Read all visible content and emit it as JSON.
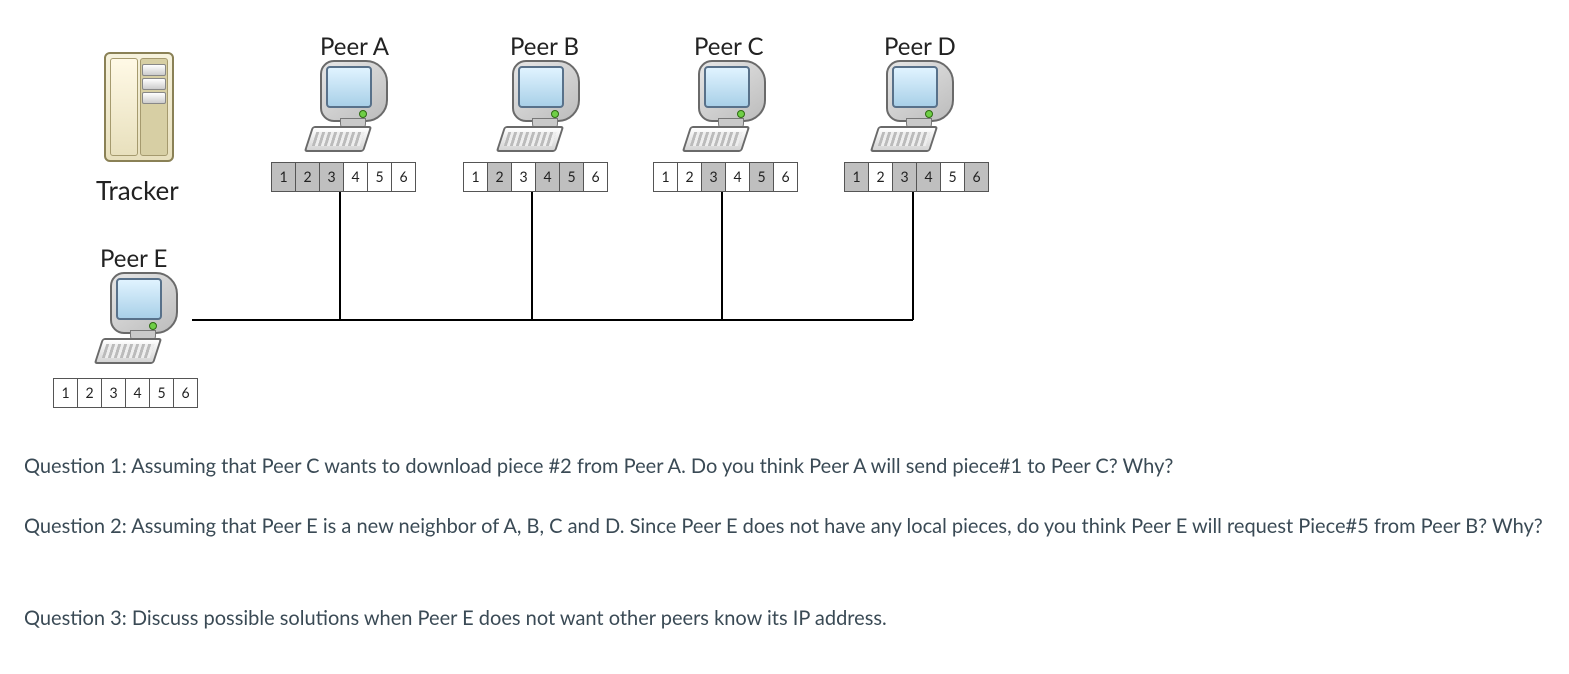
{
  "tracker": {
    "label": "Tracker"
  },
  "peers": {
    "A": {
      "label": "Peer A",
      "pieces": [
        1,
        1,
        1,
        0,
        0,
        0
      ]
    },
    "B": {
      "label": "Peer B",
      "pieces": [
        0,
        1,
        0,
        1,
        1,
        0
      ]
    },
    "C": {
      "label": "Peer C",
      "pieces": [
        0,
        0,
        1,
        0,
        1,
        0
      ]
    },
    "D": {
      "label": "Peer D",
      "pieces": [
        1,
        0,
        1,
        1,
        0,
        1
      ]
    },
    "E": {
      "label": "Peer E",
      "pieces": [
        0,
        0,
        0,
        0,
        0,
        0
      ]
    }
  },
  "piece_labels": [
    "1",
    "2",
    "3",
    "4",
    "5",
    "6"
  ],
  "questions": {
    "q1": "Question 1:  Assuming that Peer C wants to download piece #2 from Peer A.  Do you think Peer A will send piece#1 to Peer C? Why?",
    "q2": "Question 2: Assuming that Peer E is a new neighbor of A, B, C and D.  Since Peer E does not have any local pieces, do you think Peer E will request Piece#5 from Peer B? Why?",
    "q3": "Question 3: Discuss possible solutions when Peer E does not want other peers know its IP address."
  },
  "chart_data": {
    "type": "table",
    "title": "BitTorrent peers and the file pieces they currently hold",
    "piece_ids": [
      1,
      2,
      3,
      4,
      5,
      6
    ],
    "peers": [
      {
        "name": "Peer A",
        "has_pieces": [
          1,
          2,
          3
        ]
      },
      {
        "name": "Peer B",
        "has_pieces": [
          2,
          4,
          5
        ]
      },
      {
        "name": "Peer C",
        "has_pieces": [
          3,
          5
        ]
      },
      {
        "name": "Peer D",
        "has_pieces": [
          1,
          3,
          4,
          6
        ]
      },
      {
        "name": "Peer E",
        "has_pieces": []
      }
    ],
    "tracker": "Tracker",
    "topology": "Peer E is connected to Peer A, Peer B, Peer C and Peer D"
  }
}
